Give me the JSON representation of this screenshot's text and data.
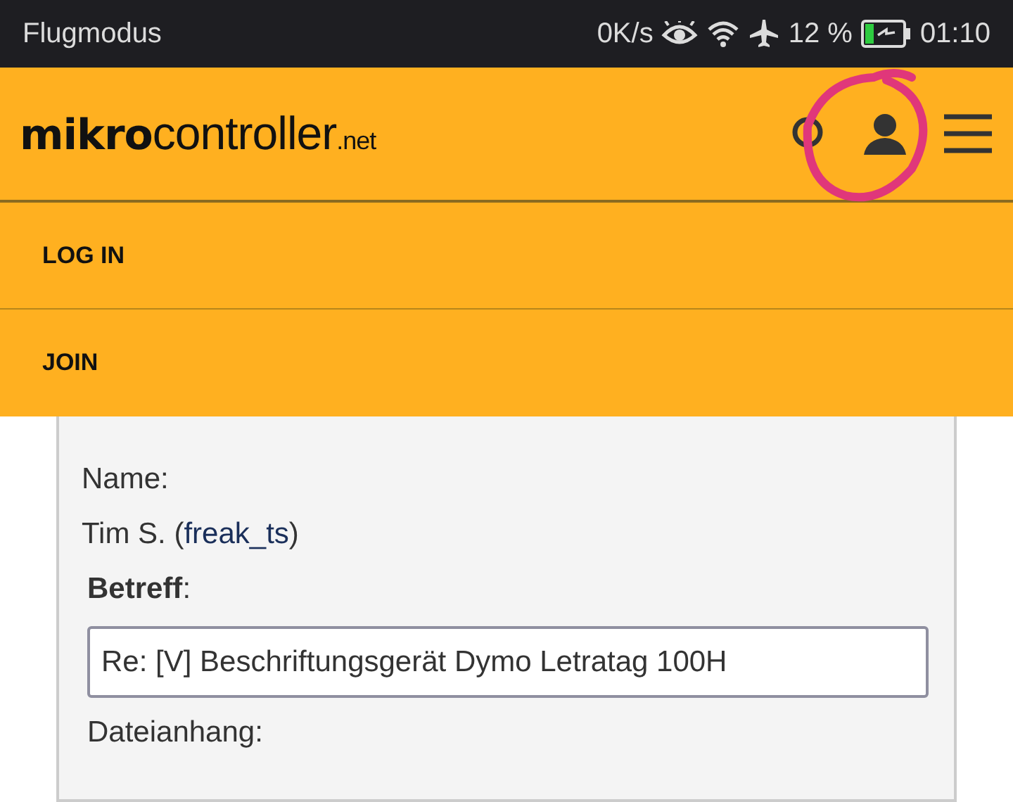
{
  "status_bar": {
    "carrier": "Flugmodus",
    "speed": "0K/s",
    "battery": "12 %",
    "time": "01:10"
  },
  "header": {
    "logo": {
      "bold": "mikro",
      "light": "controller",
      "suffix": ".net"
    }
  },
  "menu": [
    {
      "label": "LOG IN"
    },
    {
      "label": "JOIN"
    }
  ],
  "form": {
    "name_label": "Name:",
    "author": {
      "prefix": "Tim S. (",
      "link": "freak_ts",
      "suffix": ")"
    },
    "subject_label": "**Betreff**:",
    "subject_value": "Re: [V] Beschriftungsgerät Dymo Letratag 100H",
    "attachment_label": "Dateianhang:"
  }
}
